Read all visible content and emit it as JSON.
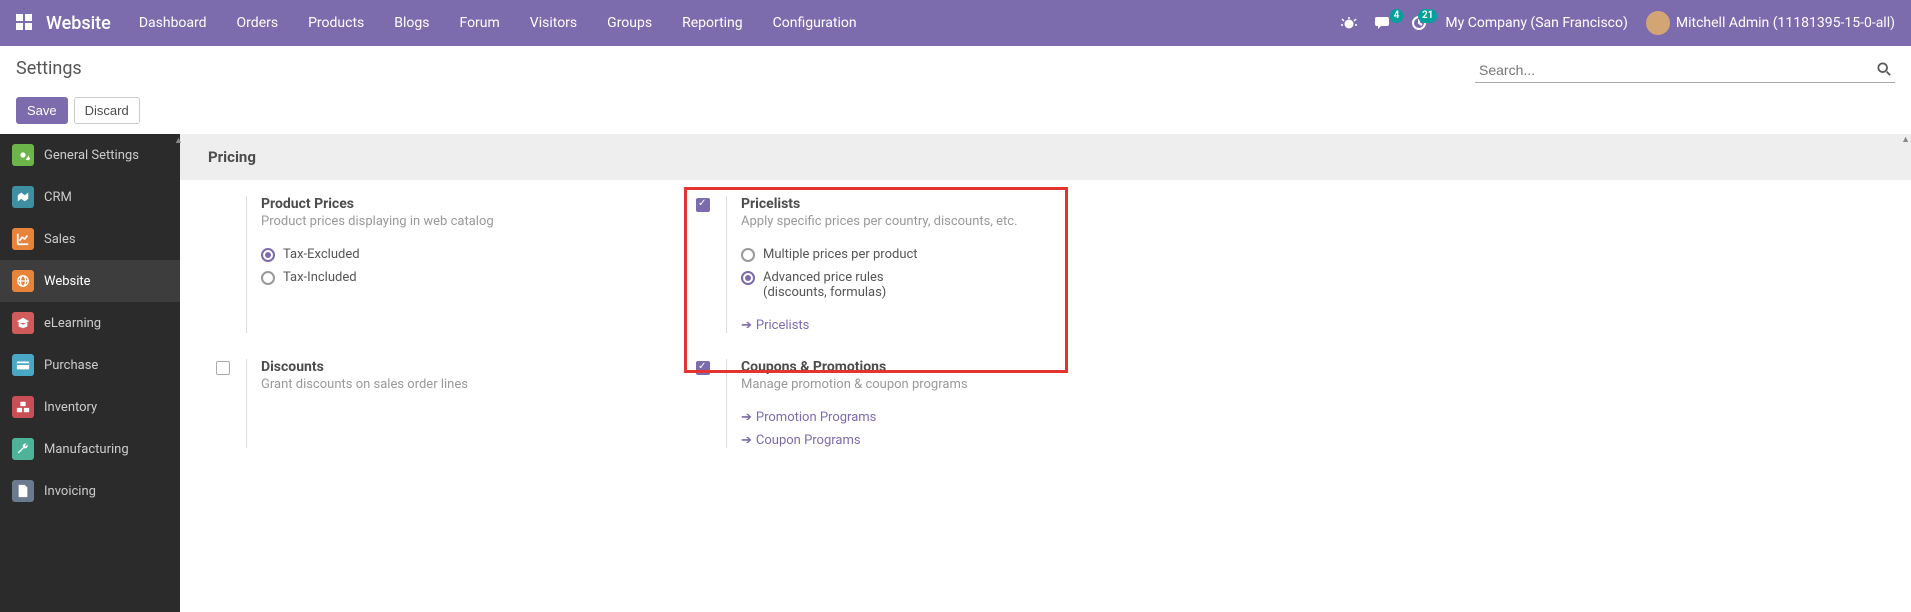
{
  "topbar": {
    "brand": "Website",
    "menu": [
      "Dashboard",
      "Orders",
      "Products",
      "Blogs",
      "Forum",
      "Visitors",
      "Groups",
      "Reporting",
      "Configuration"
    ],
    "chat_badge": "4",
    "activity_badge": "21",
    "company": "My Company (San Francisco)",
    "user": "Mitchell Admin (11181395-15-0-all)"
  },
  "controlbar": {
    "title": "Settings",
    "search_placeholder": "Search...",
    "save": "Save",
    "discard": "Discard"
  },
  "sidebar": [
    {
      "label": "General Settings",
      "color": "#6bb54b"
    },
    {
      "label": "CRM",
      "color": "#3f8fa3"
    },
    {
      "label": "Sales",
      "color": "#e8833a"
    },
    {
      "label": "Website",
      "color": "#e8833a",
      "active": true
    },
    {
      "label": "eLearning",
      "color": "#d15b5b"
    },
    {
      "label": "Purchase",
      "color": "#4aa8c4"
    },
    {
      "label": "Inventory",
      "color": "#c94e55"
    },
    {
      "label": "Manufacturing",
      "color": "#4fb39a"
    },
    {
      "label": "Invoicing",
      "color": "#6b7b8f"
    }
  ],
  "section": {
    "title": "Pricing",
    "product_prices": {
      "title": "Product Prices",
      "desc": "Product prices displaying in web catalog",
      "opts": [
        "Tax-Excluded",
        "Tax-Included"
      ]
    },
    "pricelists": {
      "title": "Pricelists",
      "desc": "Apply specific prices per country, discounts, etc.",
      "opt1": "Multiple prices per product",
      "opt2_l1": "Advanced price rules",
      "opt2_l2": "(discounts, formulas)",
      "link": "Pricelists"
    },
    "discounts": {
      "title": "Discounts",
      "desc": "Grant discounts on sales order lines"
    },
    "coupons": {
      "title": "Coupons & Promotions",
      "desc": "Manage promotion & coupon programs",
      "link1": "Promotion Programs",
      "link2": "Coupon Programs"
    }
  }
}
